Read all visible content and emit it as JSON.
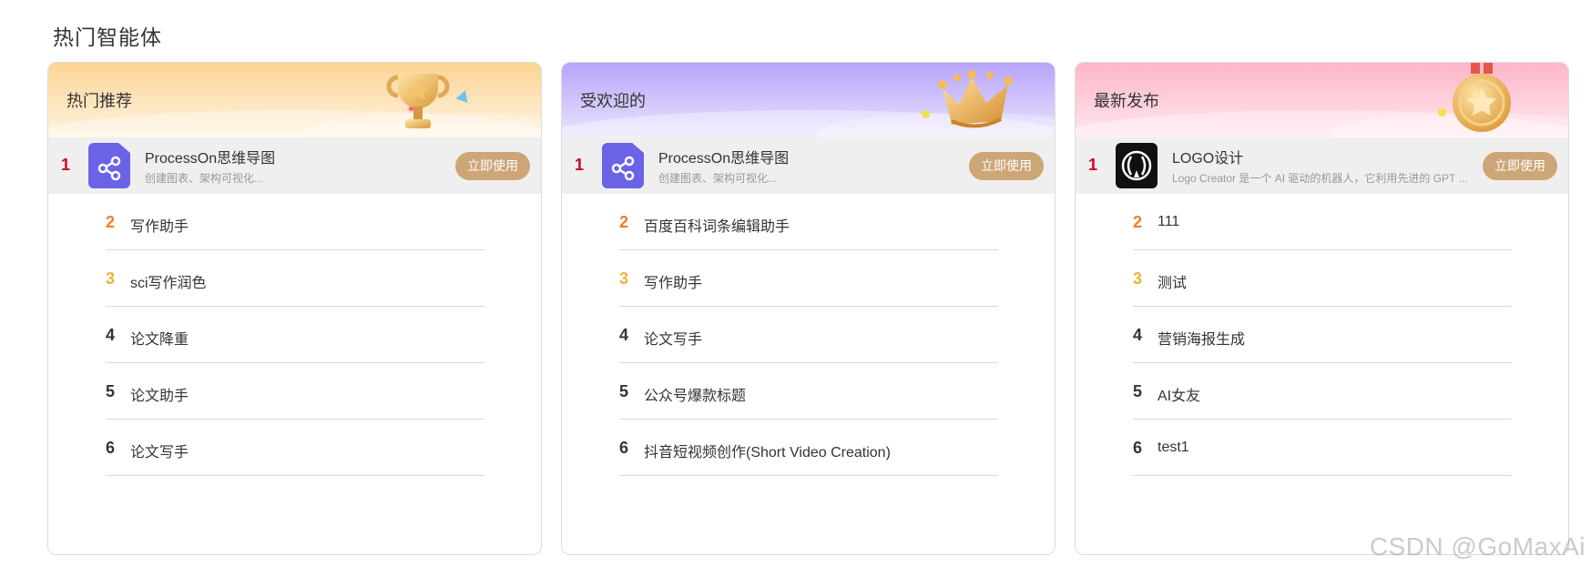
{
  "section_title": "热门智能体",
  "cards": [
    {
      "title": "热门推荐",
      "top": {
        "rank": "1",
        "icon": "processon-icon",
        "name": "ProcessOn思维导图",
        "desc": "创建图表、架构可视化...",
        "button": "立即使用"
      },
      "items": [
        {
          "rank": "2",
          "label": "写作助手"
        },
        {
          "rank": "3",
          "label": "sci写作润色"
        },
        {
          "rank": "4",
          "label": "论文降重"
        },
        {
          "rank": "5",
          "label": "论文助手"
        },
        {
          "rank": "6",
          "label": "论文写手"
        }
      ]
    },
    {
      "title": "受欢迎的",
      "top": {
        "rank": "1",
        "icon": "processon-icon",
        "name": "ProcessOn思维导图",
        "desc": "创建图表、架构可视化...",
        "button": "立即使用"
      },
      "items": [
        {
          "rank": "2",
          "label": "百度百科词条编辑助手"
        },
        {
          "rank": "3",
          "label": "写作助手"
        },
        {
          "rank": "4",
          "label": "论文写手"
        },
        {
          "rank": "5",
          "label": "公众号爆款标题"
        },
        {
          "rank": "6",
          "label": "抖音短视频创作(Short Video Creation)"
        }
      ]
    },
    {
      "title": "最新发布",
      "top": {
        "rank": "1",
        "icon": "logo-creator-icon",
        "name": "LOGO设计",
        "desc": "Logo Creator 是一个 AI 驱动的机器人，它利用先进的 GPT ...",
        "button": "立即使用"
      },
      "items": [
        {
          "rank": "2",
          "label": "111"
        },
        {
          "rank": "3",
          "label": "测试"
        },
        {
          "rank": "4",
          "label": "营销海报生成"
        },
        {
          "rank": "5",
          "label": "AI女友"
        },
        {
          "rank": "6",
          "label": "test1"
        }
      ]
    }
  ],
  "colors": {
    "rank_1": "#d0021b",
    "rank_2": "#ee7d2a",
    "rank_3": "#e8b33a",
    "button": "#cda677"
  },
  "watermark": "CSDN @GoMaxAi"
}
